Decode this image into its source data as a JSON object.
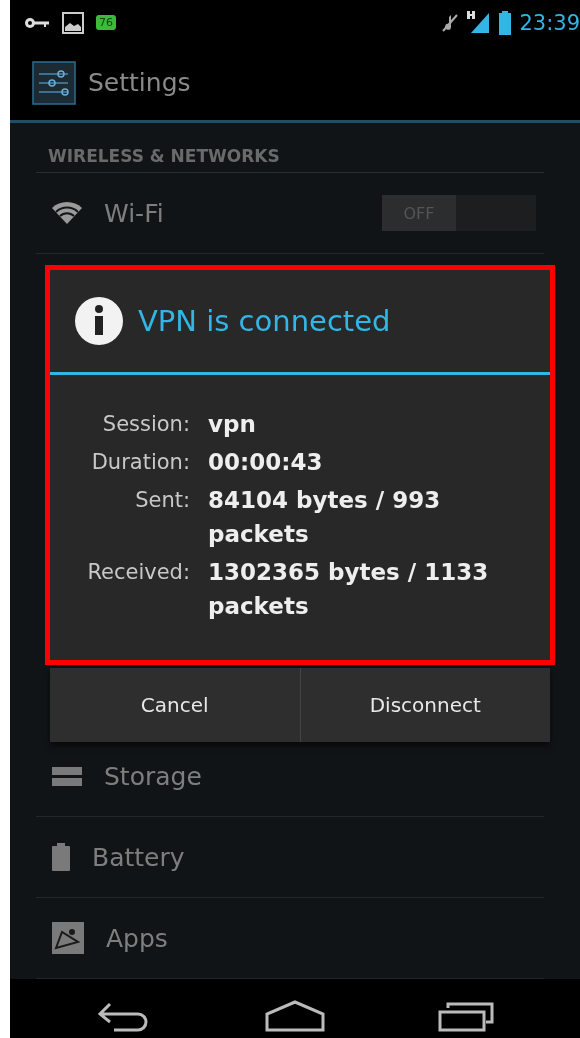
{
  "status_bar": {
    "notification_badge": "76",
    "time": "23:39"
  },
  "action_bar": {
    "title": "Settings"
  },
  "settings": {
    "section_header": "WIRELESS & NETWORKS",
    "items": [
      {
        "kind": "switch",
        "label": "Wi-Fi",
        "switch": {
          "on": false,
          "label": "OFF"
        }
      },
      {
        "kind": "plain",
        "label": "Storage"
      },
      {
        "kind": "plain",
        "label": "Battery"
      },
      {
        "kind": "plain",
        "label": "Apps"
      }
    ]
  },
  "dialog": {
    "title": "VPN is connected",
    "rows": [
      {
        "label": "Session:",
        "value": "vpn"
      },
      {
        "label": "Duration:",
        "value": "00:00:43"
      },
      {
        "label": "Sent:",
        "value": "84104 bytes / 993 packets"
      },
      {
        "label": "Received:",
        "value": "1302365 bytes / 1133 packets"
      }
    ],
    "buttons": [
      "Cancel",
      "Disconnect"
    ]
  }
}
